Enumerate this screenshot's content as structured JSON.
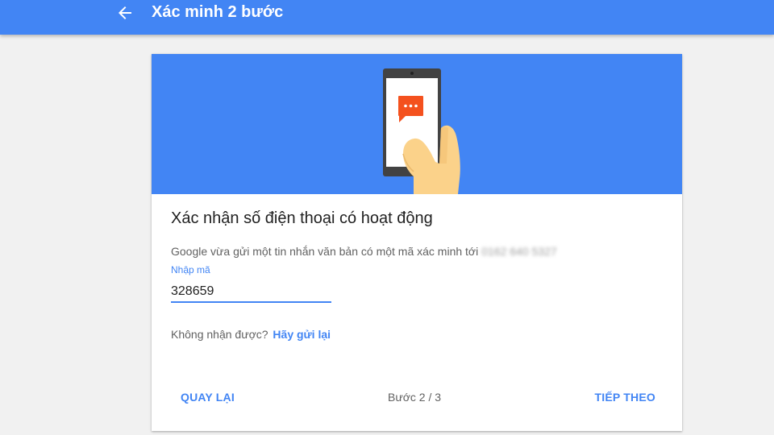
{
  "header": {
    "title": "Xác minh 2 bước",
    "back_icon": "arrow-back-icon"
  },
  "card": {
    "hero_icon": "phone-in-hand-message-icon",
    "title": "Xác nhận số điện thoại có hoạt động",
    "description": "Google vừa gửi một tin nhắn văn bản có một mã xác minh tới",
    "phone_number": "0162 640 5327",
    "code_field": {
      "label": "Nhập mã",
      "value": "328659"
    },
    "resend": {
      "prompt": "Không nhận được?",
      "link": "Hãy gửi lại"
    },
    "footer": {
      "back_label": "QUAY LẠI",
      "step_label": "Bước 2 / 3",
      "next_label": "TIẾP THEO"
    }
  },
  "colors": {
    "primary": "#4285f4",
    "background": "#f1f1f1",
    "message_bubble": "#f4511e",
    "hand": "#fbd28a"
  }
}
